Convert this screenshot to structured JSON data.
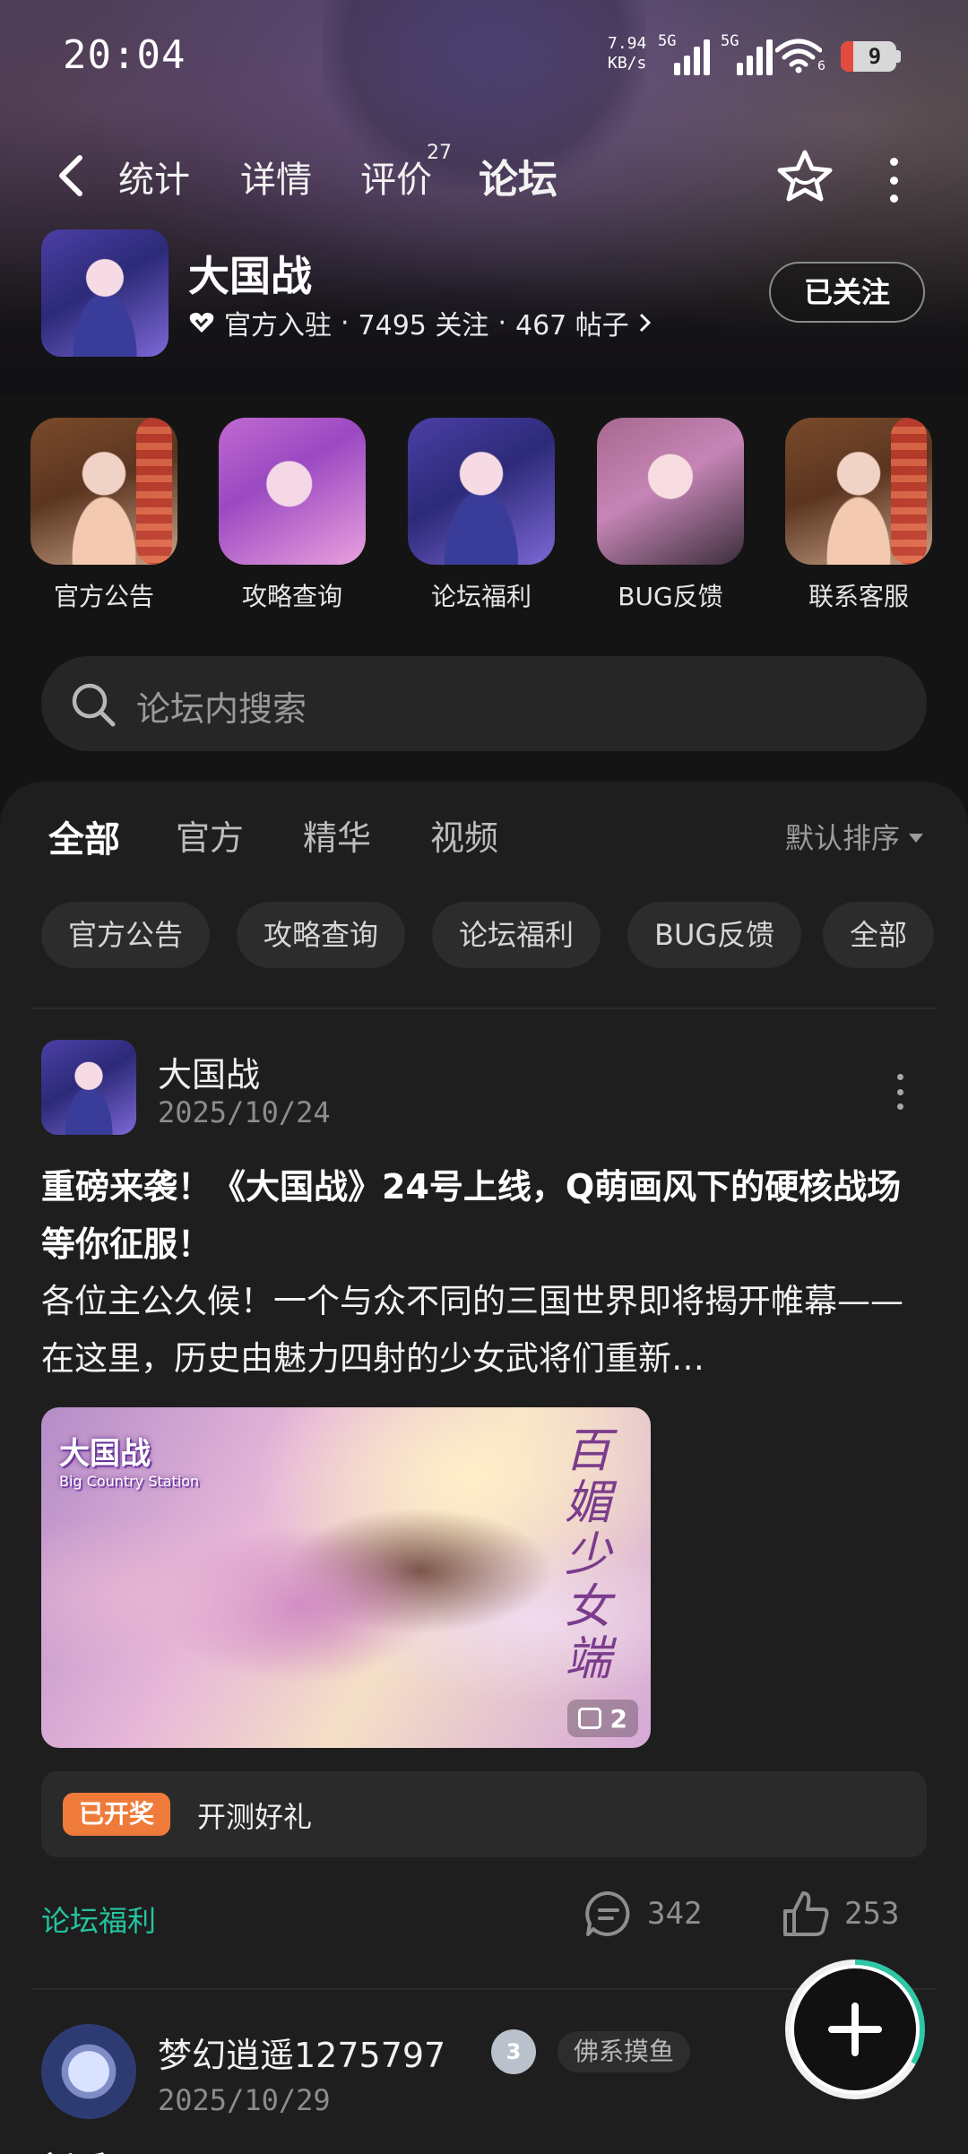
{
  "status_bar": {
    "time": "20:04",
    "net_speed_value": "7.94",
    "net_speed_unit": "KB/s",
    "sim1_label": "5G",
    "sim2_label": "5G",
    "wifi_label": "6",
    "battery": "9"
  },
  "nav": {
    "tabs": [
      {
        "label": "统计"
      },
      {
        "label": "详情"
      },
      {
        "label": "评价"
      },
      {
        "label": "论坛"
      }
    ],
    "active_tab": "论坛",
    "review_count": "27"
  },
  "forum": {
    "name": "大国战",
    "badge": "官方入驻",
    "followers": "7495 关注",
    "posts": "467 帖子",
    "follow_button": "已关注"
  },
  "quick_entries": [
    {
      "label": "官方公告",
      "icon": "portrait-red-fan"
    },
    {
      "label": "攻略查询",
      "icon": "portrait-pink-hair"
    },
    {
      "label": "论坛福利",
      "icon": "portrait-purple-hair"
    },
    {
      "label": "BUG反馈",
      "icon": "portrait-pink-hair-dark"
    },
    {
      "label": "联系客服",
      "icon": "portrait-red-fan"
    }
  ],
  "search": {
    "placeholder": "论坛内搜索"
  },
  "feed": {
    "tabs": [
      {
        "label": "全部"
      },
      {
        "label": "官方"
      },
      {
        "label": "精华"
      },
      {
        "label": "视频"
      }
    ],
    "active_tab": "全部",
    "sort_label": "默认排序",
    "chips": [
      "官方公告",
      "攻略查询",
      "论坛福利",
      "BUG反馈",
      "全部"
    ]
  },
  "posts": [
    {
      "author": "大国战",
      "date": "2025/10/24",
      "title": "重磅来袭！《大国战》24号上线，Q萌画风下的硬核战场等你征服！",
      "body": "各位主公久候！一个与众不同的三国世界即将揭开帷幕——在这里，历史由魅力四射的少女武将们重新…",
      "image_logo": "大国战",
      "image_logo_sub": "Big Country Station",
      "image_callig": "百媚少女端",
      "image_count": "2",
      "lottery_badge": "已开奖",
      "lottery_text": "开测好礼",
      "tag": "论坛福利",
      "comments": "342",
      "likes": "253"
    },
    {
      "author": "梦幻逍遥1275797",
      "level": "3",
      "tag_chip": "佛系摸鱼",
      "date": "2025/10/29",
      "title_peek": "新手"
    }
  ],
  "colors": {
    "accent": "#15c39a",
    "tag": "#25c3a0",
    "lottery": "#ef7b3a",
    "panel_bg": "#1e1e1e"
  }
}
